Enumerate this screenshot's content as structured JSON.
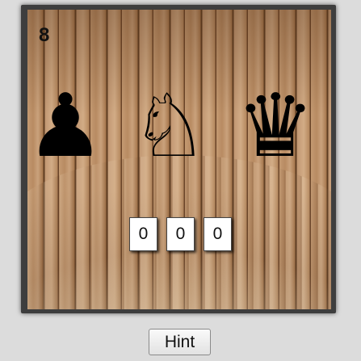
{
  "game": {
    "counter": "8",
    "pieces": [
      {
        "name": "pawn",
        "glyph": "♟"
      },
      {
        "name": "knight",
        "glyph": "♘"
      },
      {
        "name": "queen",
        "glyph": "♛"
      }
    ],
    "digits": [
      "0",
      "0",
      "0"
    ]
  },
  "controls": {
    "hint_label": "Hint"
  }
}
